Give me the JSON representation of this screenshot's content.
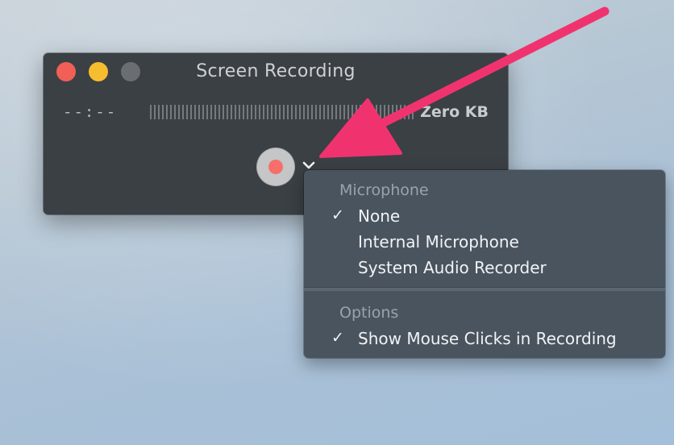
{
  "window": {
    "title": "Screen Recording",
    "time": "--:--",
    "file_size": "Zero KB",
    "record_button": "record-button",
    "colors": {
      "close": "#f15f57",
      "minimize": "#f6bd2f",
      "zoom": "#6a6e73",
      "record_dot": "#f66f6a"
    }
  },
  "menu": {
    "sections": [
      {
        "header": "Microphone",
        "items": [
          {
            "label": "None",
            "checked": true,
            "check": "✓"
          },
          {
            "label": "Internal Microphone",
            "checked": false,
            "check": ""
          },
          {
            "label": "System Audio Recorder",
            "checked": false,
            "check": ""
          }
        ]
      },
      {
        "header": "Options",
        "items": [
          {
            "label": "Show Mouse Clicks in Recording",
            "checked": true,
            "check": "✓"
          }
        ]
      }
    ]
  },
  "annotation": {
    "arrow_color": "#f0336e"
  }
}
